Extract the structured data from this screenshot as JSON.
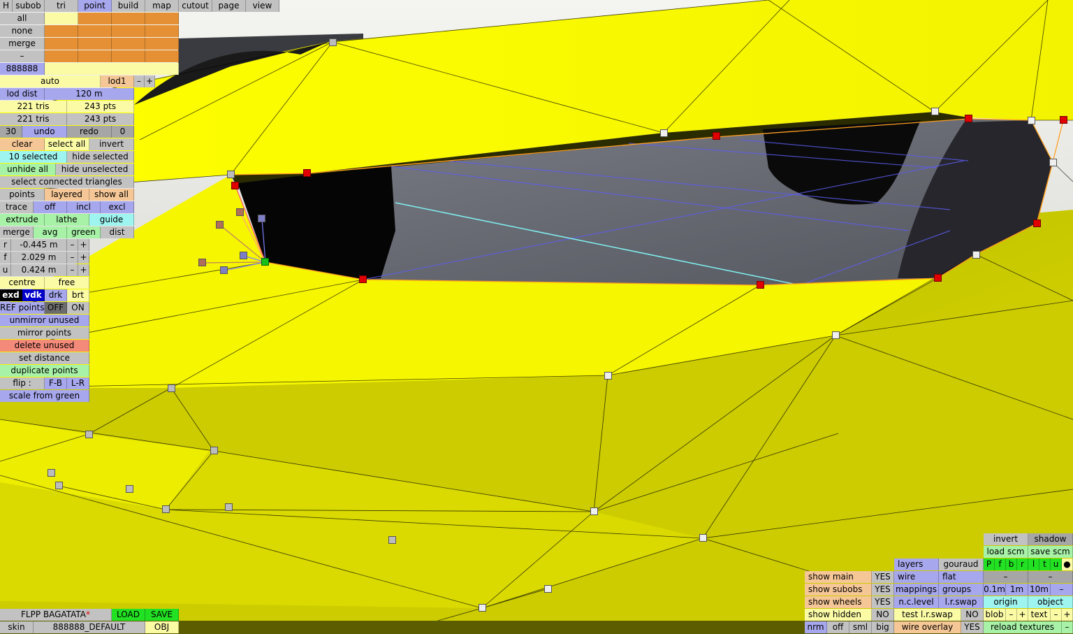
{
  "tabs": [
    {
      "label": "H",
      "name": "tab-h",
      "active": false
    },
    {
      "label": "subob",
      "name": "tab-subob",
      "active": false
    },
    {
      "label": "tri",
      "name": "tab-tri",
      "active": false
    },
    {
      "label": "point",
      "name": "tab-point",
      "active": true
    },
    {
      "label": "build",
      "name": "tab-build",
      "active": false
    },
    {
      "label": "map",
      "name": "tab-map",
      "active": false
    },
    {
      "label": "cutout",
      "name": "tab-cutout",
      "active": false
    },
    {
      "label": "page",
      "name": "tab-page",
      "active": false
    },
    {
      "label": "view",
      "name": "tab-view",
      "active": false
    }
  ],
  "selection": {
    "all": "all",
    "none": "none",
    "merge": "merge",
    "minus": "–",
    "color_code": "888888"
  },
  "lod": {
    "auto": "auto",
    "lod_label": "lod1",
    "minus": "–",
    "plus": "+",
    "dist_label": "lod dist",
    "dist_value": "120 m",
    "tris_1": "221 tris",
    "pts_1": "243 pts",
    "tris_2": "221 tris",
    "pts_2": "243 pts"
  },
  "history": {
    "count": "30",
    "undo": "undo",
    "redo": "redo",
    "redo_count": "0"
  },
  "edit": {
    "clear": "clear",
    "select_all": "select all",
    "invert": "invert",
    "selected": "10 selected",
    "hide_selected": "hide selected",
    "unhide_all": "unhide all",
    "hide_unselected": "hide unselected",
    "select_connected": "select connected triangles",
    "points": "points",
    "layered": "layered",
    "show_all": "show all",
    "trace": "trace",
    "off": "off",
    "incl": "incl",
    "excl": "excl",
    "extrude": "extrude",
    "lathe": "lathe",
    "guide": "guide",
    "merge": "merge",
    "avg": "avg",
    "green": "green",
    "dist": "dist"
  },
  "coords": [
    {
      "axis": "r",
      "value": "-0.445 m"
    },
    {
      "axis": "f",
      "value": "2.029 m"
    },
    {
      "axis": "u",
      "value": "0.424 m"
    }
  ],
  "stepper": {
    "minus": "–",
    "plus": "+"
  },
  "pivot": {
    "centre": "centre",
    "free": "free"
  },
  "shade": {
    "exd": "exd",
    "vdk": "vdk",
    "drk": "drk",
    "brt": "brt"
  },
  "ref": {
    "label": "REF points",
    "off": "OFF",
    "on": "ON"
  },
  "actions": {
    "unmirror": "unmirror unused",
    "mirror": "mirror points",
    "delete": "delete unused",
    "set_distance": "set distance",
    "duplicate": "duplicate points",
    "flip": "flip :",
    "fb": "F-B",
    "lr": "L-R",
    "scale": "scale from green"
  },
  "file": {
    "name": "FLPP BAGATATA",
    "modified": "*",
    "load": "LOAD",
    "save": "SAVE",
    "skin_label": "skin",
    "skin_value": "888888_DEFAULT",
    "obj": "OBJ"
  },
  "view_panel": {
    "show_main": "show main",
    "show_subobs": "show subobs",
    "show_wheels": "show wheels",
    "show_hidden": "show hidden",
    "yes": "YES",
    "no": "NO",
    "nrm": "nrm",
    "off": "off",
    "sml": "sml",
    "big": "big",
    "layers": "layers",
    "gouraud": "gouraud",
    "wire": "wire",
    "flat": "flat",
    "mappings": "mappings",
    "groups": "groups",
    "nc_level": "n.c.level",
    "lr_swap": "l.r.swap",
    "test_lr_swap": "test l.r.swap",
    "wire_overlay": "wire overlay",
    "invert": "invert",
    "shadow": "shadow",
    "load_scm": "load scm",
    "save_scm": "save scm",
    "view_letters": [
      "P",
      "f",
      "b",
      "r",
      "l",
      "t",
      "u"
    ],
    "dot": "●",
    "dash": "–",
    "grid_01": "0.1m",
    "grid_1": "1m",
    "grid_10": "10m",
    "origin": "origin",
    "object": "object",
    "blob": "blob",
    "text": "text",
    "reload": "reload textures"
  },
  "colors": {
    "body_yellow": "#ffff00",
    "selected_point": "#e00000",
    "green_point": "#19c019",
    "active_tab": "#a7a7ee"
  }
}
